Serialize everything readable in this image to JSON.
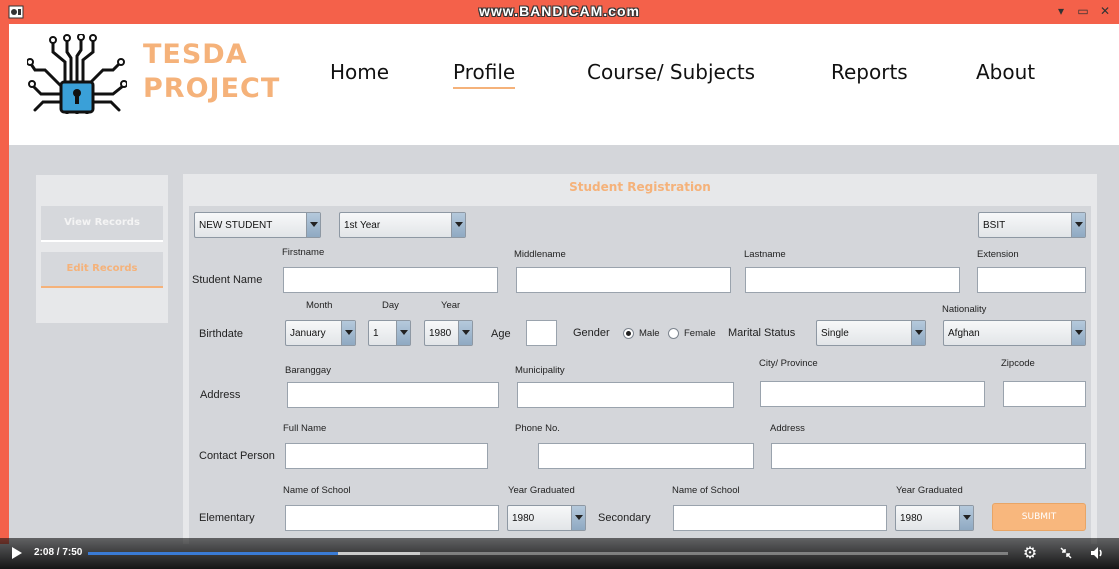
{
  "window": {
    "watermark": "www.BANDICAM.com",
    "minimize": "▾",
    "maximize": "▭",
    "close": "✕"
  },
  "brand": {
    "line1": "TESDA",
    "line2": "PROJECT",
    "accent_color": "#f5b27a"
  },
  "nav": {
    "items": [
      {
        "label": "Home"
      },
      {
        "label": "Profile",
        "active": true
      },
      {
        "label": "Course/ Subjects"
      },
      {
        "label": "Reports"
      },
      {
        "label": "About"
      }
    ]
  },
  "sidebar": {
    "view_records": "View Records",
    "edit_records": "Edit Records"
  },
  "form": {
    "title": "Student Registration",
    "student_type": "NEW STUDENT",
    "year_level": "1st Year",
    "program": "BSIT",
    "student_name": {
      "label": "Student Name",
      "firstname": "Firstname",
      "middlename": "Middlename",
      "lastname": "Lastname",
      "extension": "Extension"
    },
    "birthdate": {
      "label": "Birthdate",
      "month_label": "Month",
      "month_value": "January",
      "day_label": "Day",
      "day_value": "1",
      "year_label": "Year",
      "year_value": "1980"
    },
    "age_label": "Age",
    "gender": {
      "label": "Gender",
      "male": "Male",
      "female": "Female",
      "selected": "Male"
    },
    "marital": {
      "label": "Marital Status",
      "value": "Single"
    },
    "nationality": {
      "label": "Nationality",
      "value": "Afghan"
    },
    "address": {
      "label": "Address",
      "barangay": "Baranggay",
      "municipality": "Municipality",
      "city": "City/ Province",
      "zipcode": "Zipcode"
    },
    "contact": {
      "label": "Contact Person",
      "full_name": "Full Name",
      "phone": "Phone No.",
      "address": "Address"
    },
    "education": {
      "elementary_label": "Elementary",
      "secondary_label": "Secondary",
      "school_label": "Name of School",
      "graduated_label": "Year Graduated",
      "elem_year": "1980",
      "sec_year": "1980"
    },
    "submit": "SUBMIT"
  },
  "player": {
    "timecode": "2:08 / 7:50",
    "progress": 0.272,
    "settings_icon": "gear-icon",
    "fullscreen_icon": "minimize-arrows-icon",
    "volume_icon": "speaker-icon"
  }
}
